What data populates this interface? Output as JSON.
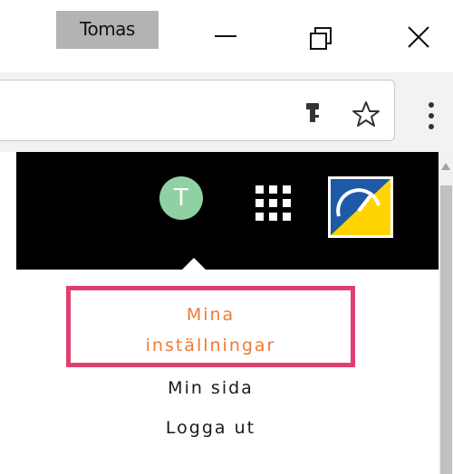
{
  "window": {
    "profile_name": "Tomas",
    "controls": [
      "minimize",
      "restore",
      "close"
    ]
  },
  "toolbar": {
    "omnibox_icons": [
      "key-icon",
      "star-icon"
    ],
    "menu_icon": "kebab-menu-icon"
  },
  "site": {
    "avatar_initial": "T",
    "avatar_color": "#8fd1a3",
    "apps_icon": "apps-grid-icon",
    "logo_colors": {
      "blue": "#1e5aa8",
      "yellow": "#ffd400"
    }
  },
  "dropdown": {
    "items": [
      {
        "label_line1": "Mina",
        "label_line2": "inställningar",
        "active": true
      },
      {
        "label": "Min sida"
      },
      {
        "label": "Logga ut"
      }
    ],
    "active_text_color": "#ee7a32",
    "active_border_color": "#e0406f"
  }
}
